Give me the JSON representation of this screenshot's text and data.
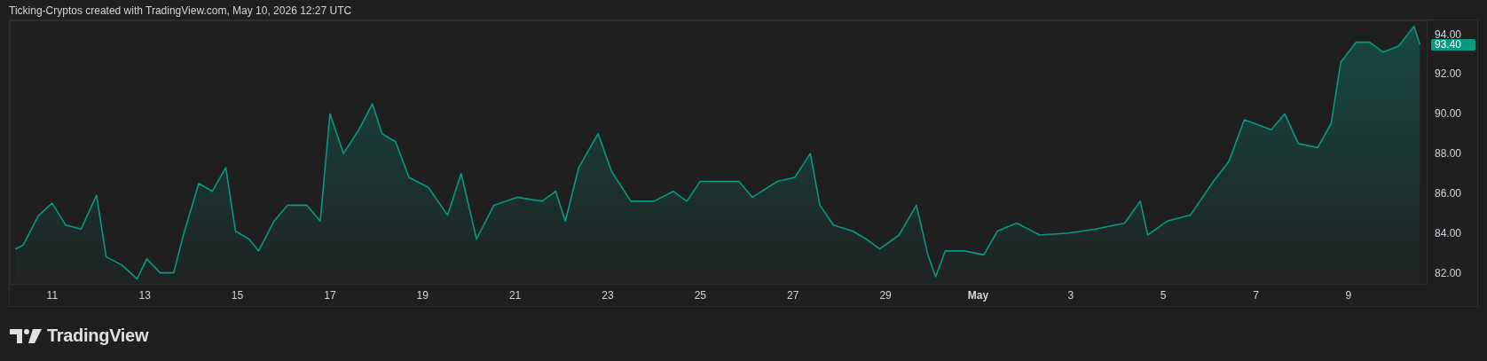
{
  "header": {
    "text": "Ticking-Cryptos created with TradingView.com, May 10, 2026 12:27 UTC"
  },
  "chart": {
    "price_label": "93.40",
    "chart_data": {
      "type": "area",
      "xlim": [
        "2026-04-10T02:00",
        "2026-05-10T17:00"
      ],
      "ylim": [
        81.4,
        94.7
      ],
      "yticks": [
        {
          "value": 82,
          "label": "82.00"
        },
        {
          "value": 84,
          "label": "84.00"
        },
        {
          "value": 86,
          "label": "86.00"
        },
        {
          "value": 88,
          "label": "88.00"
        },
        {
          "value": 90,
          "label": "90.00"
        },
        {
          "value": 92,
          "label": "92.00"
        },
        {
          "value": 94,
          "label": "94.00"
        }
      ],
      "xticks": [
        {
          "value": "2026-04-11",
          "label": "11"
        },
        {
          "value": "2026-04-13",
          "label": "13"
        },
        {
          "value": "2026-04-15",
          "label": "15"
        },
        {
          "value": "2026-04-17",
          "label": "17"
        },
        {
          "value": "2026-04-19",
          "label": "19"
        },
        {
          "value": "2026-04-21",
          "label": "21"
        },
        {
          "value": "2026-04-23",
          "label": "23"
        },
        {
          "value": "2026-04-25",
          "label": "25"
        },
        {
          "value": "2026-04-27",
          "label": "27"
        },
        {
          "value": "2026-04-29",
          "label": "29"
        },
        {
          "value": "2026-05-01",
          "label": "May"
        },
        {
          "value": "2026-05-03",
          "label": "3"
        },
        {
          "value": "2026-05-05",
          "label": "5"
        },
        {
          "value": "2026-05-07",
          "label": "7"
        },
        {
          "value": "2026-05-09",
          "label": "9"
        }
      ],
      "x": [
        "2026-04-10T05:00",
        "2026-04-10T09:00",
        "2026-04-10T17:00",
        "2026-04-11T00:00",
        "2026-04-11T07:00",
        "2026-04-11T15:00",
        "2026-04-11T23:00",
        "2026-04-12T04:00",
        "2026-04-12T12:00",
        "2026-04-12T20:00",
        "2026-04-13T01:00",
        "2026-04-13T08:00",
        "2026-04-13T15:00",
        "2026-04-13T20:00",
        "2026-04-14T04:00",
        "2026-04-14T11:00",
        "2026-04-14T18:00",
        "2026-04-14T23:00",
        "2026-04-15T06:00",
        "2026-04-15T11:00",
        "2026-04-15T19:00",
        "2026-04-16T02:00",
        "2026-04-16T12:00",
        "2026-04-16T19:00",
        "2026-04-17T00:00",
        "2026-04-17T07:00",
        "2026-04-17T15:00",
        "2026-04-17T22:00",
        "2026-04-18T03:00",
        "2026-04-18T10:00",
        "2026-04-18T17:00",
        "2026-04-19T03:00",
        "2026-04-19T13:00",
        "2026-04-19T20:00",
        "2026-04-20T04:00",
        "2026-04-20T13:00",
        "2026-04-21T01:00",
        "2026-04-21T14:00",
        "2026-04-21T21:00",
        "2026-04-22T02:00",
        "2026-04-22T09:00",
        "2026-04-22T19:00",
        "2026-04-23T02:00",
        "2026-04-23T12:00",
        "2026-04-24T00:00",
        "2026-04-24T10:00",
        "2026-04-24T17:00",
        "2026-04-25T00:00",
        "2026-04-25T10:00",
        "2026-04-25T20:00",
        "2026-04-26T03:00",
        "2026-04-26T16:00",
        "2026-04-27T01:00",
        "2026-04-27T09:00",
        "2026-04-27T14:00",
        "2026-04-27T21:00",
        "2026-04-28T07:00",
        "2026-04-28T14:00",
        "2026-04-28T21:00",
        "2026-04-29T07:00",
        "2026-04-29T16:00",
        "2026-04-29T22:00",
        "2026-04-30T02:00",
        "2026-04-30T07:00",
        "2026-04-30T17:00",
        "2026-05-01T03:00",
        "2026-05-01T10:00",
        "2026-05-01T20:00",
        "2026-05-02T08:00",
        "2026-05-02T23:00",
        "2026-05-03T13:00",
        "2026-05-04T04:00",
        "2026-05-04T12:00",
        "2026-05-04T16:00",
        "2026-05-05T02:00",
        "2026-05-05T14:00",
        "2026-05-06T02:00",
        "2026-05-06T10:00",
        "2026-05-06T18:00",
        "2026-05-07T08:00",
        "2026-05-07T15:00",
        "2026-05-07T22:00",
        "2026-05-08T08:00",
        "2026-05-08T15:00",
        "2026-05-08T20:00",
        "2026-05-09T04:00",
        "2026-05-09T11:00",
        "2026-05-09T18:00",
        "2026-05-10T02:00",
        "2026-05-10T10:00",
        "2026-05-10T13:00"
      ],
      "series": [
        {
          "color": "#089981",
          "values": [
            83.2,
            83.4,
            84.9,
            85.5,
            84.4,
            84.2,
            85.9,
            82.8,
            82.4,
            81.7,
            82.7,
            82.0,
            82.0,
            83.9,
            86.5,
            86.1,
            87.3,
            84.1,
            83.7,
            83.1,
            84.6,
            85.4,
            85.4,
            84.6,
            90.0,
            88.0,
            89.2,
            90.5,
            89.0,
            88.6,
            86.8,
            86.3,
            84.9,
            87.0,
            83.7,
            85.4,
            85.8,
            85.6,
            86.1,
            84.6,
            87.3,
            89.0,
            87.1,
            85.6,
            85.6,
            86.1,
            85.6,
            86.6,
            86.6,
            86.6,
            85.8,
            86.6,
            86.8,
            88.0,
            85.4,
            84.4,
            84.1,
            83.7,
            83.2,
            83.9,
            85.4,
            82.9,
            81.8,
            83.1,
            83.1,
            82.9,
            84.1,
            84.5,
            83.9,
            84.0,
            84.2,
            84.5,
            85.6,
            83.9,
            84.6,
            84.9,
            86.6,
            87.6,
            89.7,
            89.2,
            90.0,
            88.5,
            88.3,
            89.5,
            92.6,
            93.6,
            93.6,
            93.1,
            93.4,
            94.4,
            93.5
          ]
        }
      ]
    }
  },
  "footer": {
    "logo_text": "TradingView"
  }
}
